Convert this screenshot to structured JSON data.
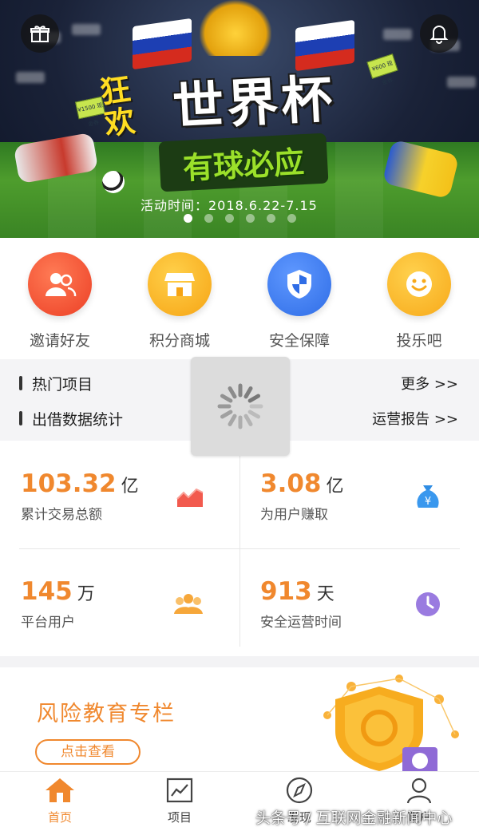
{
  "banner": {
    "title_kuang": "狂欢",
    "title_main": "世界杯",
    "title_sub": "有球必应",
    "event_time": "活动时间：2018.6.22-7.15",
    "bill_left": "¥1500 现金券",
    "bill_right": "¥600 现金券",
    "slide_count": 6,
    "active_slide": 0
  },
  "quick_actions": [
    {
      "label": "邀请好友",
      "icon": "users-icon",
      "color": "#f1583d"
    },
    {
      "label": "积分商城",
      "icon": "store-icon",
      "color": "#f9b320"
    },
    {
      "label": "安全保障",
      "icon": "shield-icon",
      "color": "#3f7df2"
    },
    {
      "label": "投乐吧",
      "icon": "smile-icon",
      "color": "#fab72a"
    }
  ],
  "info": {
    "hot_projects": "热门项目",
    "more": "更多 >>",
    "lending_stats": "出借数据统计",
    "report": "运营报告 >>"
  },
  "stats": [
    {
      "value": "103.32",
      "unit": "亿",
      "desc": "累计交易总额",
      "icon": "chart-up-icon"
    },
    {
      "value": "3.08",
      "unit": "亿",
      "desc": "为用户赚取",
      "icon": "money-bag-icon"
    },
    {
      "value": "145",
      "unit": "万",
      "desc": "平台用户",
      "icon": "crowd-icon"
    },
    {
      "value": "913",
      "unit": "天",
      "desc": "安全运营时间",
      "icon": "clock-icon"
    }
  ],
  "risk": {
    "title": "风险教育专栏",
    "button": "点击查看"
  },
  "nav": [
    {
      "label": "首页",
      "icon": "home-icon",
      "active": true
    },
    {
      "label": "项目",
      "icon": "chart-icon",
      "active": false
    },
    {
      "label": "发现",
      "icon": "compass-icon",
      "active": false
    },
    {
      "label": "账户",
      "icon": "user-icon",
      "active": false
    }
  ],
  "watermark": "头条号 / 互联网金融新闻中心",
  "colors": {
    "accent": "#f0882e",
    "background": "#f3f3f5"
  }
}
